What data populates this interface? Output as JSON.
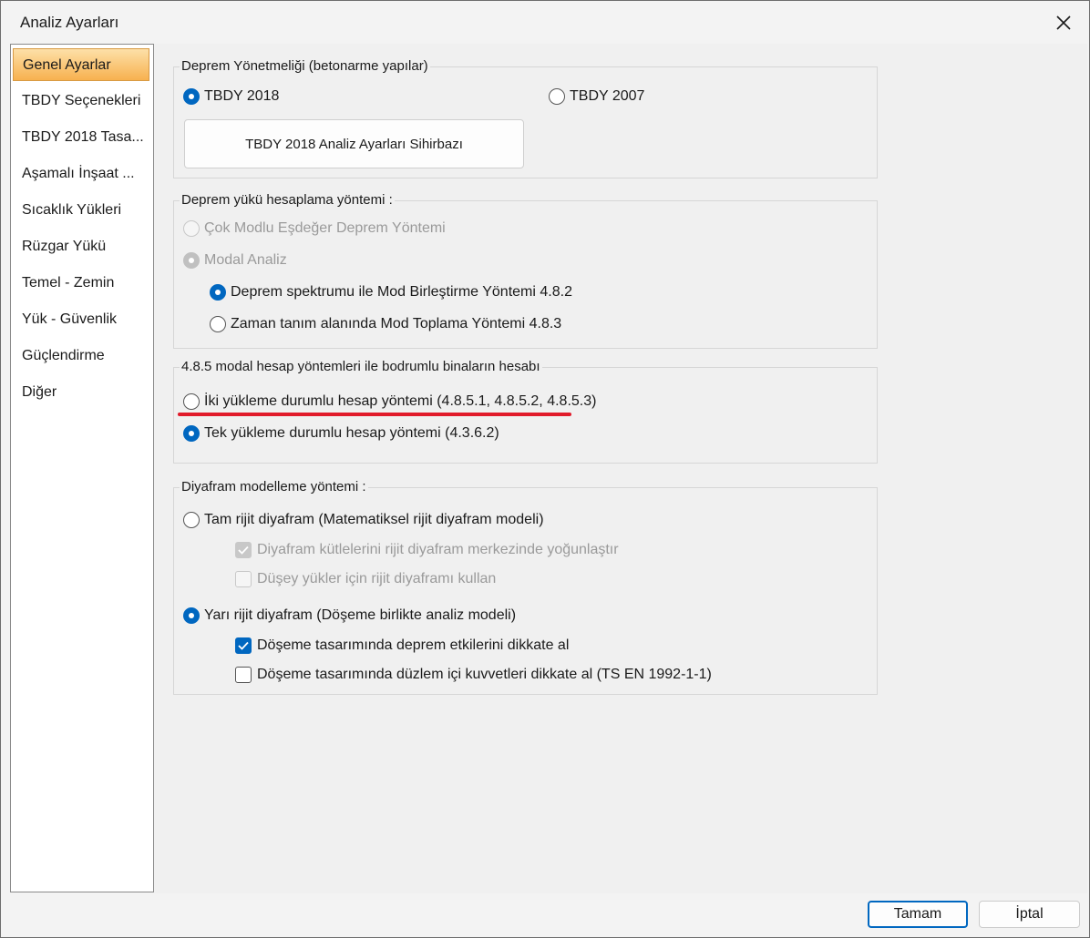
{
  "window": {
    "title": "Analiz Ayarları"
  },
  "sidebar": {
    "items": [
      {
        "label": "Genel Ayarlar"
      },
      {
        "label": "TBDY Seçenekleri"
      },
      {
        "label": "TBDY 2018 Tasa..."
      },
      {
        "label": "Aşamalı İnşaat ..."
      },
      {
        "label": "Sıcaklık Yükleri"
      },
      {
        "label": "Rüzgar Yükü"
      },
      {
        "label": "Temel - Zemin"
      },
      {
        "label": "Yük - Güvenlik"
      },
      {
        "label": "Güçlendirme"
      },
      {
        "label": "Diğer"
      }
    ]
  },
  "groups": {
    "regulation": {
      "label": "Deprem Yönetmeliği (betonarme yapılar)",
      "tbdy2018": "TBDY 2018",
      "tbdy2007": "TBDY 2007",
      "wizard_button": "TBDY 2018 Analiz Ayarları Sihirbazı"
    },
    "method": {
      "label": "Deprem yükü hesaplama yöntemi :",
      "multi_mode": "Çok Modlu Eşdeğer Deprem Yöntemi",
      "modal": "Modal Analiz",
      "spectrum": "Deprem spektrumu ile Mod Birleştirme Yöntemi 4.8.2",
      "time_history": "Zaman tanım alanında Mod Toplama Yöntemi 4.8.3"
    },
    "basement": {
      "label": "4.8.5 modal hesap yöntemleri ile bodrumlu binaların hesabı",
      "two_load": "İki yükleme durumlu hesap yöntemi (4.8.5.1, 4.8.5.2, 4.8.5.3)",
      "single_load": "Tek yükleme durumlu hesap yöntemi (4.3.6.2)"
    },
    "diaphragm": {
      "label": "Diyafram modelleme yöntemi  :",
      "rigid": "Tam rijit diyafram (Matematiksel rijit diyafram modeli)",
      "rigid_mass": "Diyafram kütlelerini rijit diyafram merkezinde yoğunlaştır",
      "rigid_vertical": "Düşey yükler için rijit diyaframı kullan",
      "semi_rigid": "Yarı rijit diyafram (Döşeme birlikte analiz modeli)",
      "slab_seismic": "Döşeme tasarımında deprem etkilerini dikkate al",
      "slab_inplane": "Döşeme tasarımında düzlem içi kuvvetleri dikkate al (TS EN 1992-1-1)"
    }
  },
  "footer": {
    "ok": "Tamam",
    "cancel": "İptal"
  },
  "colors": {
    "accent": "#0067c0",
    "highlight": "#e11b2a",
    "active_item": "#f7b14f"
  }
}
